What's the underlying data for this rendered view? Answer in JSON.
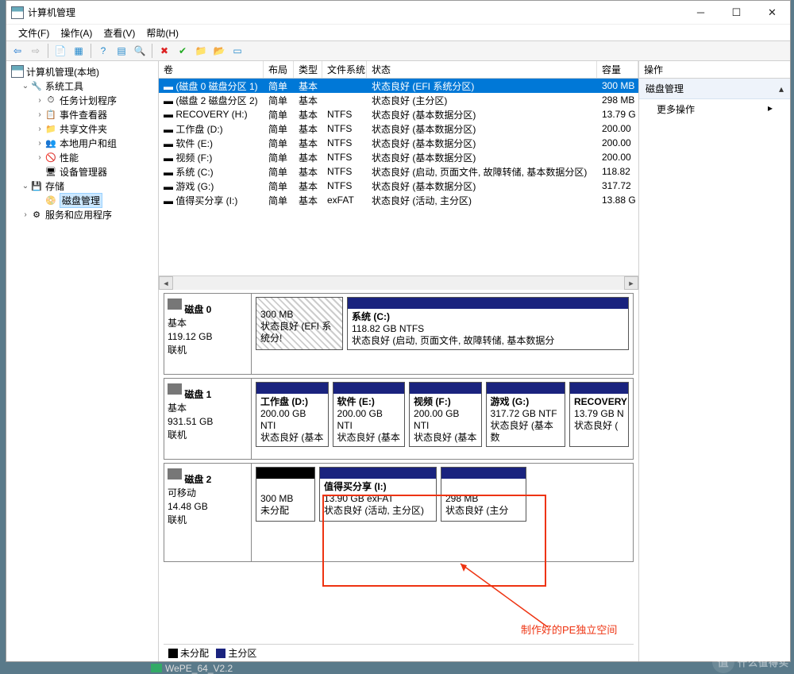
{
  "window": {
    "title": "计算机管理"
  },
  "menu": {
    "file": "文件(F)",
    "action": "操作(A)",
    "view": "查看(V)",
    "help": "帮助(H)"
  },
  "tree": {
    "root": "计算机管理(本地)",
    "systools": "系统工具",
    "task": "任务计划程序",
    "event": "事件查看器",
    "share": "共享文件夹",
    "users": "本地用户和组",
    "perf": "性能",
    "devmgr": "设备管理器",
    "storage": "存储",
    "diskmgmt": "磁盘管理",
    "svcapp": "服务和应用程序"
  },
  "vcols": {
    "vol": "卷",
    "layout": "布局",
    "type": "类型",
    "fs": "文件系统",
    "status": "状态",
    "cap": "容量"
  },
  "volumes": [
    {
      "vol": "(磁盘 0 磁盘分区 1)",
      "layout": "简单",
      "type": "基本",
      "fs": "",
      "status": "状态良好 (EFI 系统分区)",
      "cap": "300 MB",
      "sel": true
    },
    {
      "vol": "(磁盘 2 磁盘分区 2)",
      "layout": "简单",
      "type": "基本",
      "fs": "",
      "status": "状态良好 (主分区)",
      "cap": "298 MB"
    },
    {
      "vol": "RECOVERY (H:)",
      "layout": "简单",
      "type": "基本",
      "fs": "NTFS",
      "status": "状态良好 (基本数据分区)",
      "cap": "13.79 G"
    },
    {
      "vol": "工作盘 (D:)",
      "layout": "简单",
      "type": "基本",
      "fs": "NTFS",
      "status": "状态良好 (基本数据分区)",
      "cap": "200.00"
    },
    {
      "vol": "软件 (E:)",
      "layout": "简单",
      "type": "基本",
      "fs": "NTFS",
      "status": "状态良好 (基本数据分区)",
      "cap": "200.00"
    },
    {
      "vol": "视频 (F:)",
      "layout": "简单",
      "type": "基本",
      "fs": "NTFS",
      "status": "状态良好 (基本数据分区)",
      "cap": "200.00"
    },
    {
      "vol": "系统 (C:)",
      "layout": "简单",
      "type": "基本",
      "fs": "NTFS",
      "status": "状态良好 (启动, 页面文件, 故障转储, 基本数据分区)",
      "cap": "118.82"
    },
    {
      "vol": "游戏 (G:)",
      "layout": "简单",
      "type": "基本",
      "fs": "NTFS",
      "status": "状态良好 (基本数据分区)",
      "cap": "317.72"
    },
    {
      "vol": "值得买分享 (I:)",
      "layout": "简单",
      "type": "基本",
      "fs": "exFAT",
      "status": "状态良好 (活动, 主分区)",
      "cap": "13.88 G"
    }
  ],
  "disks": {
    "d0": {
      "name": "磁盘 0",
      "bustype": "基本",
      "size": "119.12 GB",
      "state": "联机",
      "efi": {
        "size": "300 MB",
        "status": "状态良好 (EFI 系统分!"
      },
      "c": {
        "title": "系统  (C:)",
        "size": "118.82 GB NTFS",
        "status": "状态良好 (启动, 页面文件, 故障转储, 基本数据分"
      }
    },
    "d1": {
      "name": "磁盘 1",
      "bustype": "基本",
      "size": "931.51 GB",
      "state": "联机",
      "d": {
        "title": "工作盘  (D:)",
        "size": "200.00 GB NTI",
        "status": "状态良好 (基本"
      },
      "e": {
        "title": "软件  (E:)",
        "size": "200.00 GB NTI",
        "status": "状态良好 (基本"
      },
      "f": {
        "title": "视频  (F:)",
        "size": "200.00 GB NTI",
        "status": "状态良好 (基本"
      },
      "g": {
        "title": "游戏  (G:)",
        "size": "317.72 GB NTF",
        "status": "状态良好 (基本数"
      },
      "h": {
        "title": "RECOVERY",
        "size": "13.79 GB N",
        "status": "状态良好 ("
      }
    },
    "d2": {
      "name": "磁盘 2",
      "bustype": "可移动",
      "size": "14.48 GB",
      "state": "联机",
      "u": {
        "size": "300 MB",
        "status": "未分配"
      },
      "i": {
        "title": "值得买分享  (I:)",
        "size": "13.90 GB exFAT",
        "status": "状态良好 (活动, 主分区)"
      },
      "p": {
        "size": "298 MB",
        "status": "状态良好 (主分"
      }
    }
  },
  "legend": {
    "unalloc": "未分配",
    "primary": "主分区"
  },
  "actions": {
    "title": "操作",
    "cat": "磁盘管理",
    "more": "更多操作"
  },
  "annotation": "制作好的PE独立空间",
  "taskbar": "WePE_64_V2.2",
  "watermark": "什么值得买"
}
